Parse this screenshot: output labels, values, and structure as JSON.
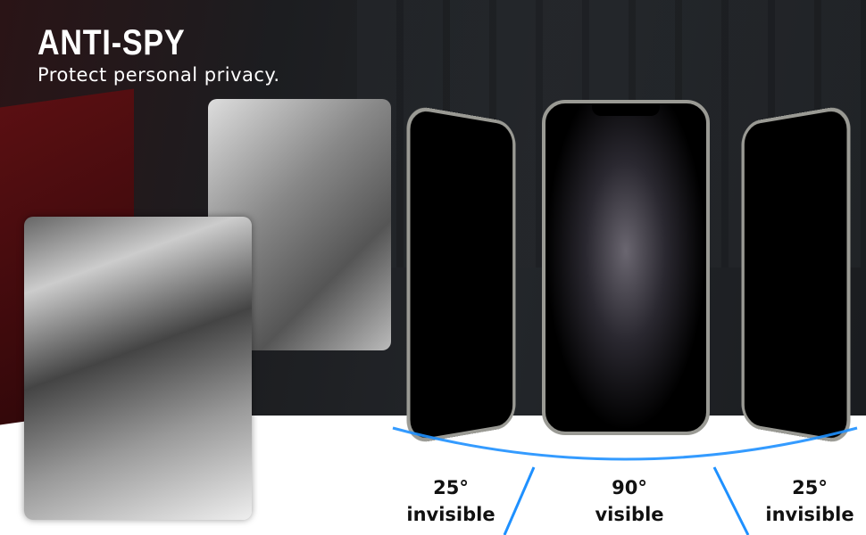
{
  "header": {
    "title": "ANTI-SPY",
    "subtitle": "Protect personal privacy."
  },
  "angles": [
    {
      "angle": "25°",
      "state": "invisible"
    },
    {
      "angle": "90°",
      "state": "visible"
    },
    {
      "angle": "25°",
      "state": "invisible"
    }
  ],
  "colors": {
    "accent": "#1e90ff"
  }
}
